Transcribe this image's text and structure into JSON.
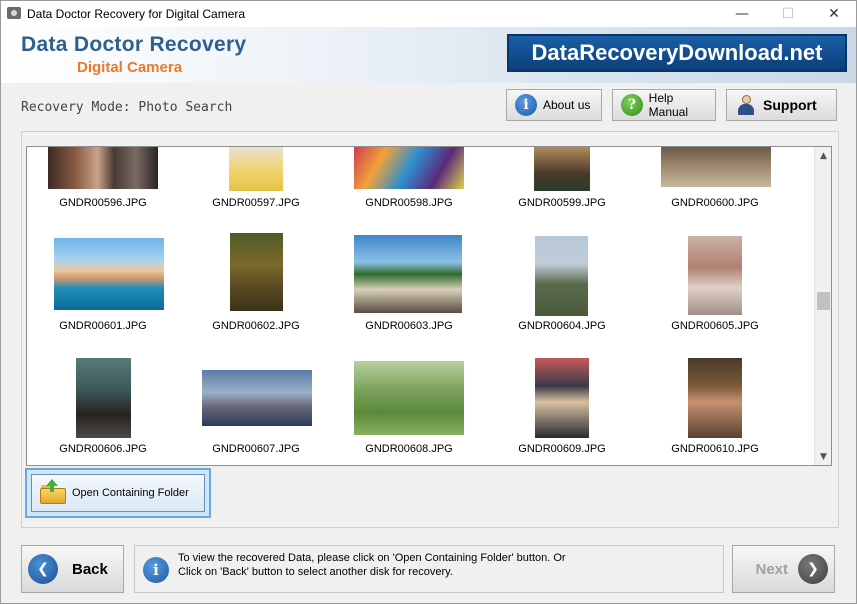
{
  "window": {
    "title": "Data Doctor Recovery for Digital Camera",
    "controls": {
      "minimize": "—",
      "maximize": "☐",
      "close": "✕"
    }
  },
  "header": {
    "brand_line1": "Data Doctor Recovery",
    "brand_line2": "Digital Camera",
    "site_badge": "DataRecoveryDownload.net"
  },
  "toolbar": {
    "mode_label": "Recovery Mode: Photo Search",
    "about_label": "About us",
    "help_label": "Help Manual",
    "support_label": "Support"
  },
  "gallery": {
    "items": [
      {
        "filename": "GNDR00596.JPG"
      },
      {
        "filename": "GNDR00597.JPG"
      },
      {
        "filename": "GNDR00598.JPG"
      },
      {
        "filename": "GNDR00599.JPG"
      },
      {
        "filename": "GNDR00600.JPG"
      },
      {
        "filename": "GNDR00601.JPG"
      },
      {
        "filename": "GNDR00602.JPG"
      },
      {
        "filename": "GNDR00603.JPG"
      },
      {
        "filename": "GNDR00604.JPG"
      },
      {
        "filename": "GNDR00605.JPG"
      },
      {
        "filename": "GNDR00606.JPG"
      },
      {
        "filename": "GNDR00607.JPG"
      },
      {
        "filename": "GNDR00608.JPG"
      },
      {
        "filename": "GNDR00609.JPG"
      },
      {
        "filename": "GNDR00610.JPG"
      }
    ],
    "scroll_up": "▲",
    "scroll_down": "▼"
  },
  "actions": {
    "open_folder_label": "Open Containing Folder",
    "back_label": "Back",
    "next_label": "Next",
    "back_arrow": "❮",
    "next_arrow": "❯"
  },
  "info": {
    "line1": "To view the recovered Data, please click on 'Open Containing Folder' button. Or",
    "line2": "Click on 'Back' button to select another disk for recovery."
  },
  "colors": {
    "brand_blue": "#2f5f8f",
    "brand_orange": "#e87a2c",
    "badge_blue": "#0b3f7a"
  }
}
